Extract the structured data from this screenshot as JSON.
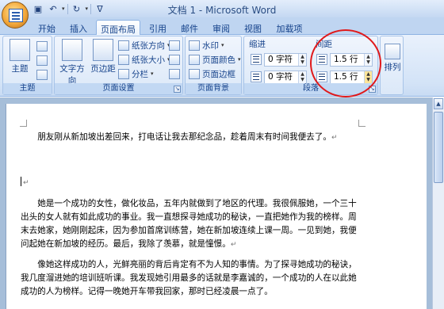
{
  "window": {
    "title": "文档 1 - Microsoft Word"
  },
  "qat": {
    "icons": [
      "save-icon",
      "undo-icon",
      "redo-icon",
      "customize-icon"
    ]
  },
  "tabs": [
    {
      "label": "开始",
      "active": false
    },
    {
      "label": "插入",
      "active": false
    },
    {
      "label": "页面布局",
      "active": true
    },
    {
      "label": "引用",
      "active": false
    },
    {
      "label": "邮件",
      "active": false
    },
    {
      "label": "审阅",
      "active": false
    },
    {
      "label": "视图",
      "active": false
    },
    {
      "label": "加载项",
      "active": false
    }
  ],
  "ribbon": {
    "theme_group": {
      "label": "主题",
      "button": "主题"
    },
    "page_setup": {
      "label": "页面设置",
      "text_direction": "文字方向",
      "margins": "页边距",
      "orientation": "纸张方向",
      "size": "纸张大小",
      "columns": "分栏"
    },
    "page_background": {
      "label": "页面背景",
      "watermark": "水印",
      "page_color": "页面颜色",
      "page_borders": "页面边框"
    },
    "paragraph": {
      "label": "段落",
      "indent_title": "缩进",
      "spacing_title": "间距",
      "indent_left": "0 字符",
      "indent_right": "0 字符",
      "spacing_before": "1.5 行",
      "spacing_after": "1.5 行"
    },
    "arrange": {
      "button": "排列"
    }
  },
  "document": {
    "paragraphs": [
      "朋友刚从新加坡出差回来，打电话让我去那纪念品，趁着周末有时间我便去了。",
      "她是一个成功的女性，做化妆品，五年内就做到了地区的代理。我很佩服她，一个三十出头的女人就有如此成功的事业。我一直想探寻她成功的秘诀，一直把她作为我的榜样。周末去她家，她刚刚起床，因为参加首席训练营，她在新加坡连续上课一周。一见到她，我便问起她在新加坡的经历。最后，我除了羡慕，就是憧憬。",
      "像她这样成功的人，光鲜亮丽的背后肯定有不为人知的事情。为了探寻她成功的秘诀，我几度溜进她的培训班听课。我发现她引用最多的话就是李嘉诚的，一个成功的人在以此她成功的人为榜样。记得一晚她开车带我回家，那时已经凌晨一点了。"
    ],
    "para_mark": "↵"
  }
}
